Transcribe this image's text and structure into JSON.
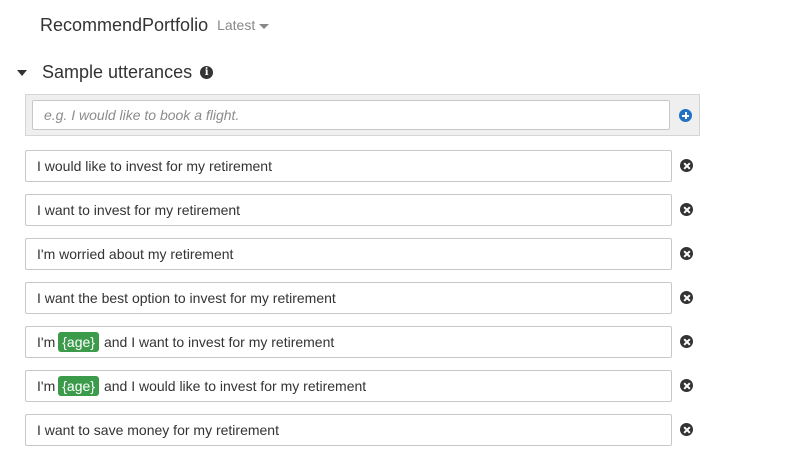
{
  "header": {
    "intent_name": "RecommendPortfolio",
    "version_label": "Latest"
  },
  "section": {
    "title": "Sample utterances",
    "info_icon": "info-icon"
  },
  "new_utterance": {
    "placeholder": "e.g. I would like to book a flight.",
    "value": "",
    "add_icon": "plus-circle-icon"
  },
  "utterances": [
    {
      "text": "I would like to invest for my retirement"
    },
    {
      "text": "I want to invest for my retirement"
    },
    {
      "text": "I'm worried about my retirement"
    },
    {
      "text": "I want the best option to invest for my retirement"
    },
    {
      "before": "I'm",
      "slot": "{age}",
      "after": "and I want to invest for my retirement"
    },
    {
      "before": "I'm",
      "slot": "{age}",
      "after": "and I would like to invest for my retirement"
    },
    {
      "text": "I want to save money for my retirement"
    }
  ],
  "colors": {
    "slot_chip": "#3c9b4b",
    "add_icon": "#1f72c4",
    "remove_icon": "#333333"
  }
}
